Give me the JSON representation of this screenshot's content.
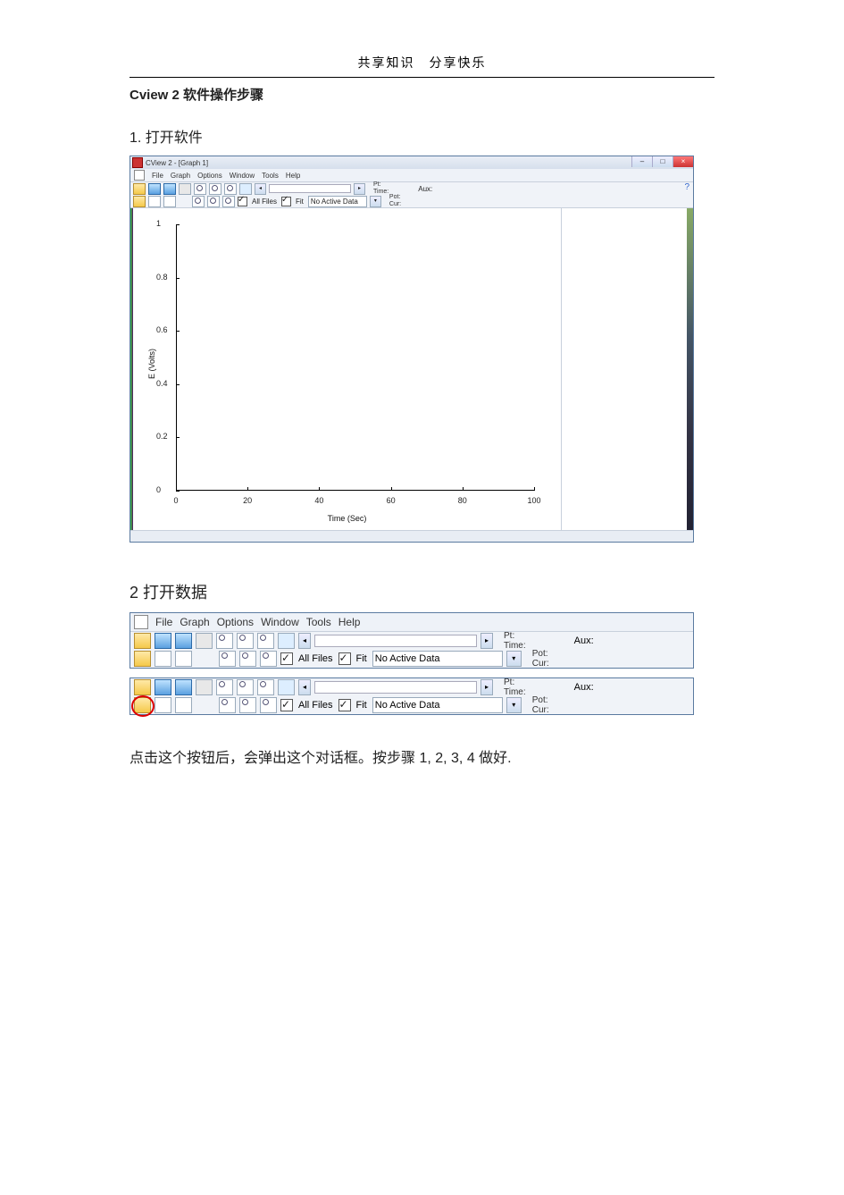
{
  "doc": {
    "header": "共享知识　分享快乐",
    "title": "Cview 2  软件操作步骤",
    "section1": "1.  打开软件",
    "section2": "2 打开数据",
    "paragraph": "点击这个按钮后，会弹出这个对话框。按步骤 1, 2, 3, 4 做好."
  },
  "app": {
    "window_title": "CView 2 - [Graph 1]",
    "menus": [
      "File",
      "Graph",
      "Options",
      "Window",
      "Tools",
      "Help"
    ],
    "all_files_label": "All Files",
    "fit_label": "Fit",
    "no_active_data": "No Active Data",
    "status": {
      "pt": "Pt:",
      "time": "Time:",
      "pot": "Pot:",
      "cur": "Cur:",
      "aux": "Aux:"
    }
  },
  "chart_data": {
    "type": "line",
    "title": "",
    "xlabel": "Time (Sec)",
    "ylabel": "E (Volts)",
    "xlim": [
      0,
      100
    ],
    "ylim": [
      0,
      1.0
    ],
    "x_ticks": [
      0,
      20,
      40,
      60,
      80,
      100
    ],
    "y_ticks": [
      0,
      0.2,
      0.4,
      0.6,
      0.8,
      1.0
    ],
    "series": []
  }
}
